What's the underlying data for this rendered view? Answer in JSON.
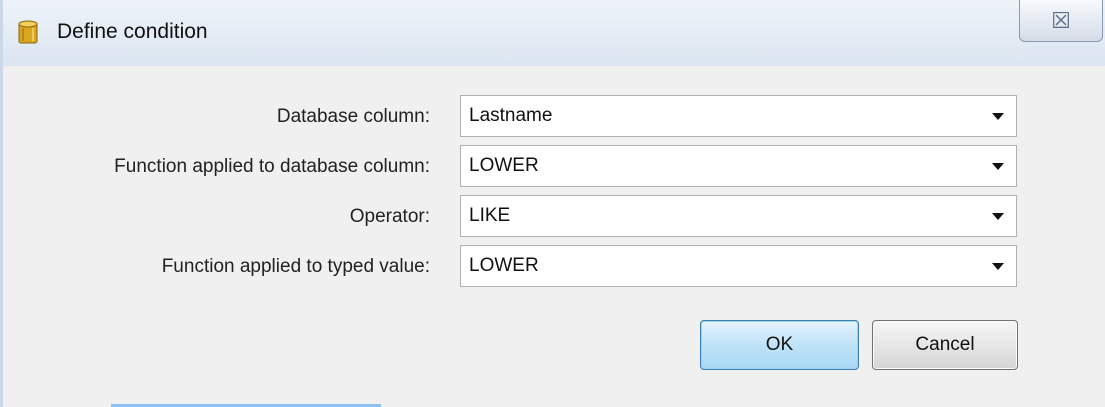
{
  "window": {
    "title": "Define condition",
    "icon": "database-icon",
    "close_symbol": "☒"
  },
  "form": {
    "rows": [
      {
        "label": "Database column:",
        "value": "Lastname"
      },
      {
        "label": "Function applied to database column:",
        "value": "LOWER"
      },
      {
        "label": "Operator:",
        "value": "LIKE"
      },
      {
        "label": "Function applied to typed value:",
        "value": "LOWER"
      }
    ]
  },
  "buttons": {
    "ok": "OK",
    "cancel": "Cancel"
  },
  "colors": {
    "ok_border": "#3c7fb1",
    "ok_fill": "#bfe3f8",
    "dialog_bg": "#f0f0f0"
  }
}
